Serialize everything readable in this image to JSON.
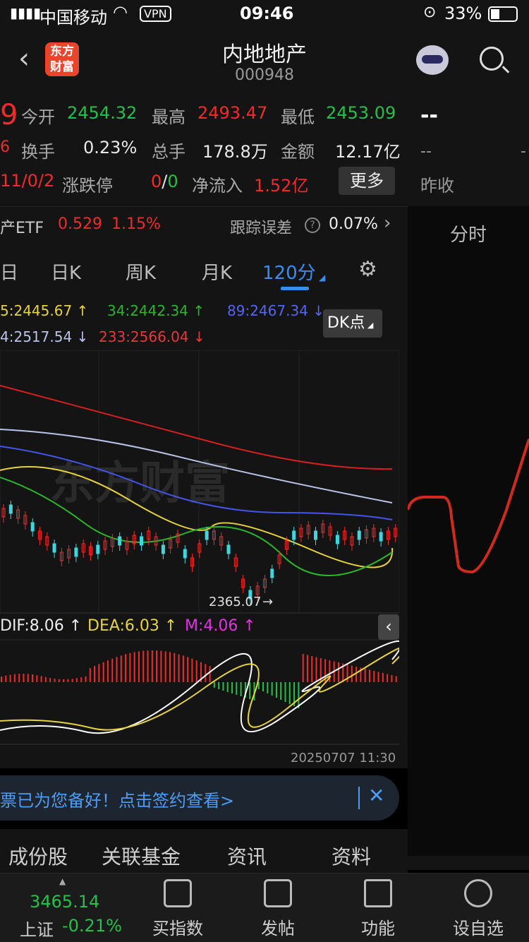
{
  "status": {
    "carrier": "中国移动",
    "vpn": "VPN",
    "time": "09:46",
    "battery": "33%"
  },
  "header": {
    "logo_line1": "东方",
    "logo_line2": "财富",
    "title": "内地地产",
    "code": "000948"
  },
  "quote": {
    "left_big": "9",
    "left_small1": "6",
    "left_small2": "11/0/2",
    "open_label": "今开",
    "open_value": "2454.32",
    "high_label": "最高",
    "high_value": "2493.47",
    "low_label": "最低",
    "low_value": "2453.09",
    "turnover_label": "换手",
    "turnover_value": "0.23%",
    "volume_label": "总手",
    "volume_value": "178.8万",
    "amount_label": "金额",
    "amount_value": "12.17亿",
    "limit_label": "涨跌停",
    "limit_up": "0",
    "limit_sep": "/",
    "limit_down": "0",
    "netflow_label": "净流入",
    "netflow_value": "1.52亿",
    "more_button": "更多"
  },
  "etf": {
    "name": "产ETF",
    "price": "0.529",
    "change": "1.15%",
    "track_label": "跟踪误差",
    "track_value": "0.07%"
  },
  "right": {
    "dashes": "--",
    "dash2": "--",
    "dash3": "-",
    "prev_close_label": "昨收",
    "fenshi": "分时"
  },
  "tabs": [
    "日",
    "日K",
    "周K",
    "月K",
    "120分"
  ],
  "ma": {
    "ma5": "5:2445.67",
    "ma34": "34:2442.34",
    "ma89": "89:2467.34",
    "ma144": "4:2517.54",
    "ma233": "233:2566.04",
    "dk_button": "DK点"
  },
  "chart": {
    "low_label": "2365.07",
    "date_label": "20250707 11:30",
    "watermark": "东方财富"
  },
  "macd": {
    "dif": "DIF:8.06",
    "dea": "DEA:6.03",
    "m": "M:4.06"
  },
  "banner": {
    "text": "票已为您备好！点击签约查看>"
  },
  "bottom_tabs": [
    "成份股",
    "关联基金",
    "资讯",
    "资料"
  ],
  "nav": {
    "index_value": "3465.14",
    "index_name": "上证",
    "index_change": "-0.21%",
    "items": [
      "买指数",
      "发帖",
      "功能",
      "设自选"
    ]
  },
  "colors": {
    "up": "#f12a2a",
    "down": "#22c14a",
    "accent": "#3b8cf0"
  }
}
